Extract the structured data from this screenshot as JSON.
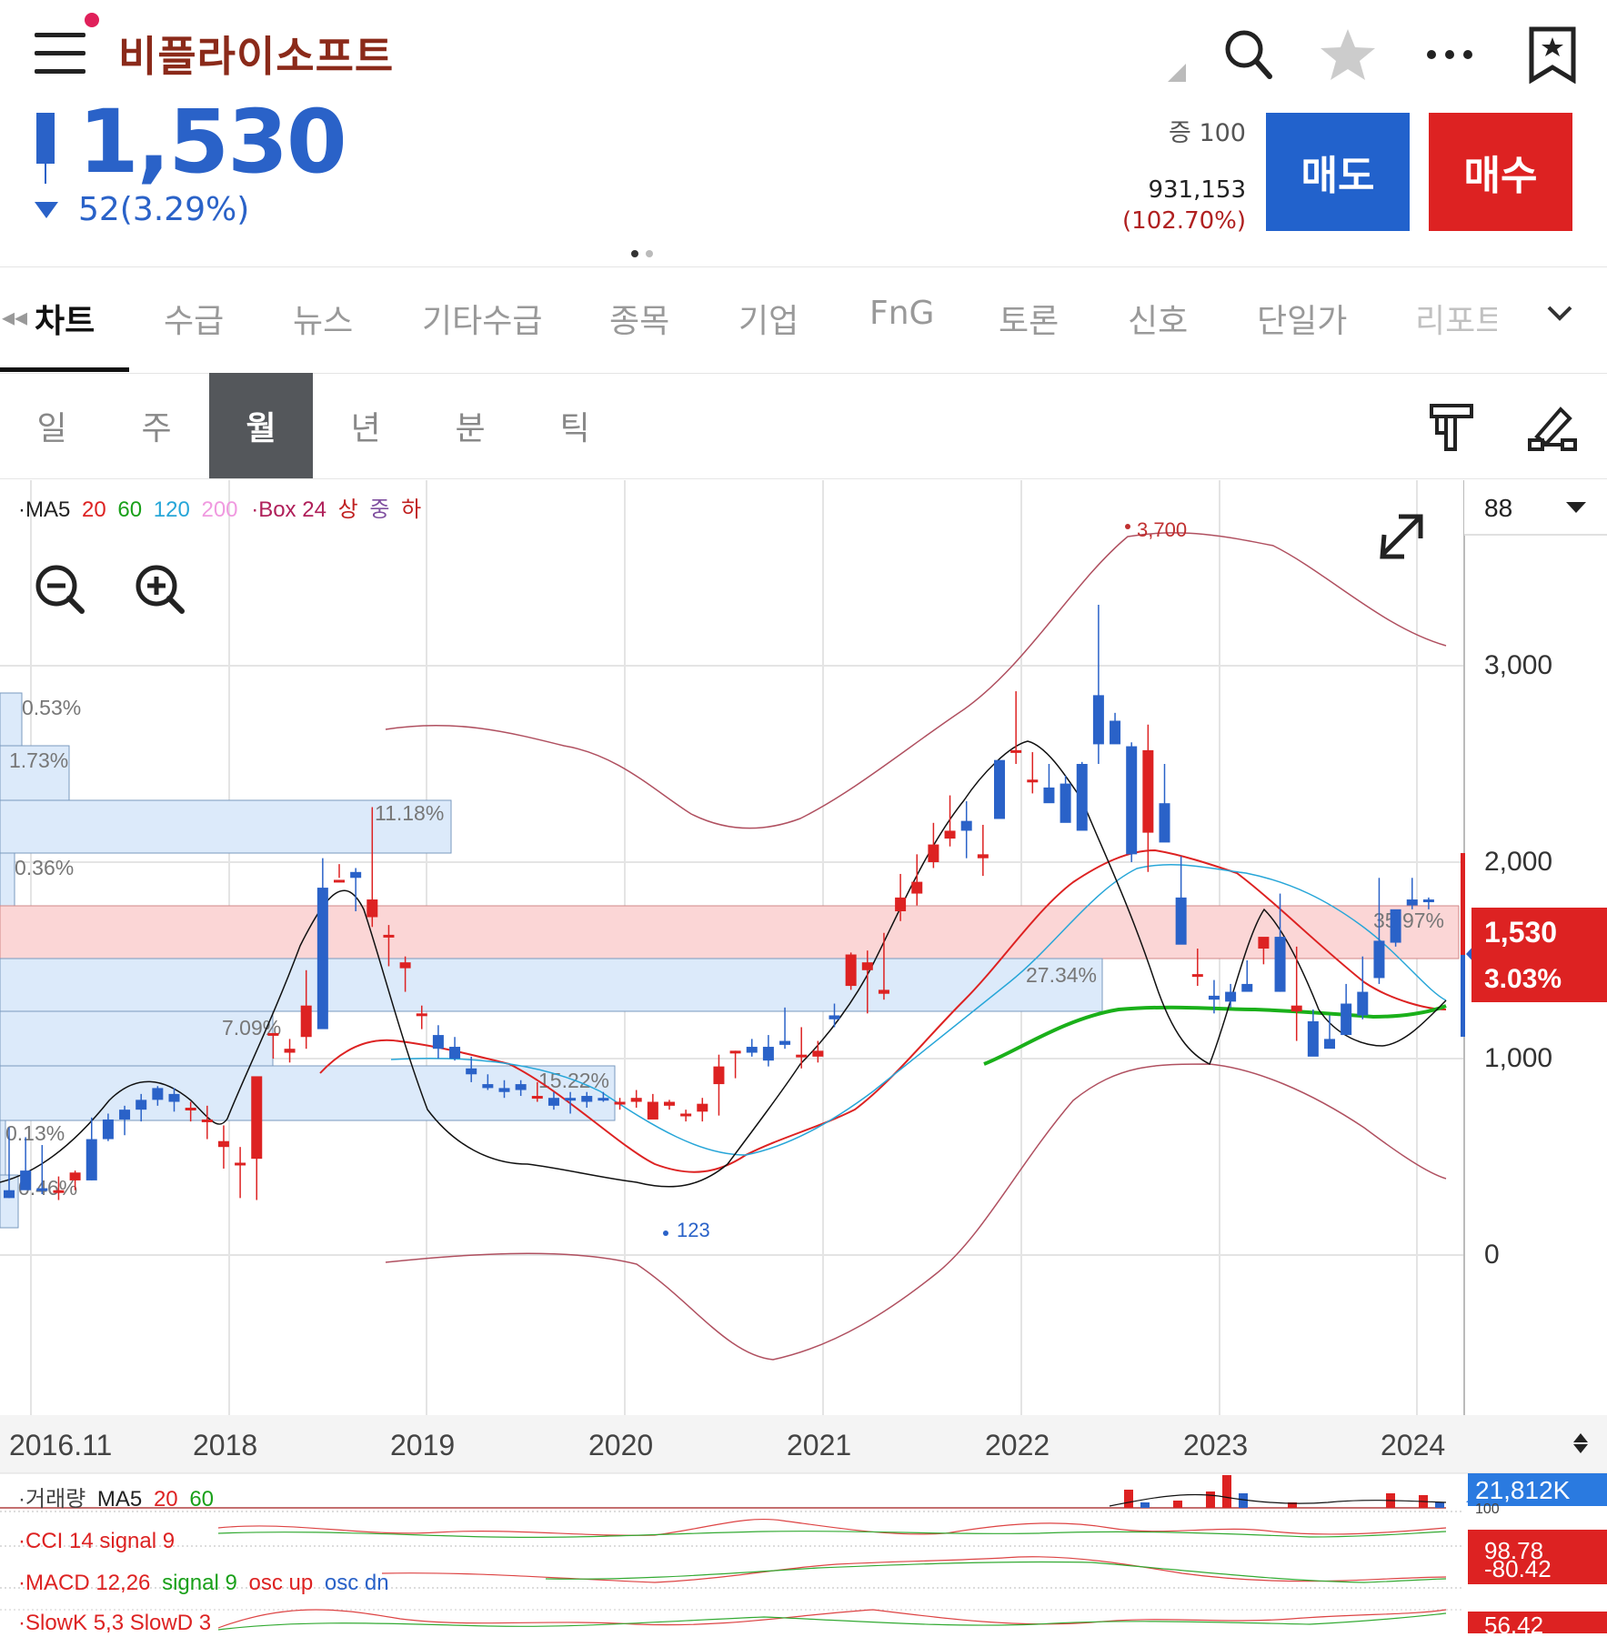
{
  "header": {
    "stock_name": "비플라이소프트",
    "price": "1,530",
    "change": "52(3.29%)",
    "margin": "증 100",
    "volume": "931,153",
    "volume_pct": "(102.70%)",
    "sell_label": "매도",
    "buy_label": "매수",
    "icons": [
      "menu-icon",
      "search-icon",
      "star-icon",
      "more-icon",
      "bookmark-icon"
    ],
    "colors": {
      "down": "#2a62c8",
      "up": "#dd2222",
      "name": "#8b2a1a"
    }
  },
  "tabs": [
    "차트",
    "수급",
    "뉴스",
    "기타수급",
    "종목",
    "기업",
    "FnG",
    "토론",
    "신호",
    "단일가",
    "리포트"
  ],
  "periods": [
    "일",
    "주",
    "월",
    "년",
    "분",
    "틱"
  ],
  "active_period": "월",
  "chart": {
    "legend_ma": "·MA5",
    "ma_periods": [
      "20",
      "60",
      "120",
      "200"
    ],
    "legend_box": "·Box 24",
    "box_labels": [
      "상",
      "중",
      "하"
    ],
    "count_select": "88",
    "y_ticks": [
      "3,000",
      "2,000",
      "1,000",
      "0"
    ],
    "current_price": "1,530",
    "current_pct": "3.03%",
    "high_label": "3,700",
    "low_label": "123",
    "x_ticks": [
      "2016.11",
      "2018",
      "2019",
      "2020",
      "2021",
      "2022",
      "2023",
      "2024"
    ],
    "volume_profile_pcts": [
      "0.53%",
      "1.73%",
      "11.18%",
      "0.36%",
      "35.97%",
      "27.34%",
      "7.09%",
      "15.22%",
      "0.13%",
      "0.46%"
    ],
    "volume_max": "21,812K",
    "volume_tick": "100",
    "cci_values": "98.78",
    "macd_value": "-80.42",
    "slow_value": "56.42"
  },
  "indicators": {
    "volume_prefix": "·거래량",
    "volume_ma": "MA5",
    "volume_ma_20": "20",
    "volume_ma_60": "60",
    "cci_label": "·CCI 14 signal 9",
    "macd_label_prefix": "·MACD 12,26",
    "macd_signal": "signal 9",
    "macd_osc_up": "osc up",
    "macd_osc_dn": "osc dn",
    "slow_label": "·SlowK 5,3 SlowD 3"
  },
  "chart_data": {
    "type": "candlestick",
    "period": "monthly",
    "x_range": [
      "2016.11",
      "2024"
    ],
    "ylim": [
      0,
      3700
    ],
    "y_ticks": [
      0,
      1000,
      2000,
      3000
    ],
    "period_high": 3700,
    "period_low": 123,
    "last_close": 1530,
    "last_change_pct": 3.03,
    "series": [
      {
        "name": "MA5",
        "color": "#000000"
      },
      {
        "name": "20",
        "color": "#dd2222"
      },
      {
        "name": "60",
        "color": "#1aa01a"
      },
      {
        "name": "120",
        "color": "#27a6d8"
      },
      {
        "name": "200",
        "color": "#f09ae0"
      }
    ],
    "volume_profile": [
      {
        "label": "0.53%",
        "high_zone": false
      },
      {
        "label": "1.73%",
        "high_zone": false
      },
      {
        "label": "11.18%",
        "high_zone": false
      },
      {
        "label": "0.36%",
        "high_zone": false
      },
      {
        "label": "35.97%",
        "high_zone": true
      },
      {
        "label": "27.34%",
        "high_zone": false
      },
      {
        "label": "7.09%",
        "high_zone": false
      },
      {
        "label": "15.22%",
        "high_zone": false
      },
      {
        "label": "0.13%",
        "high_zone": false
      },
      {
        "label": "0.46%",
        "high_zone": false
      }
    ]
  }
}
